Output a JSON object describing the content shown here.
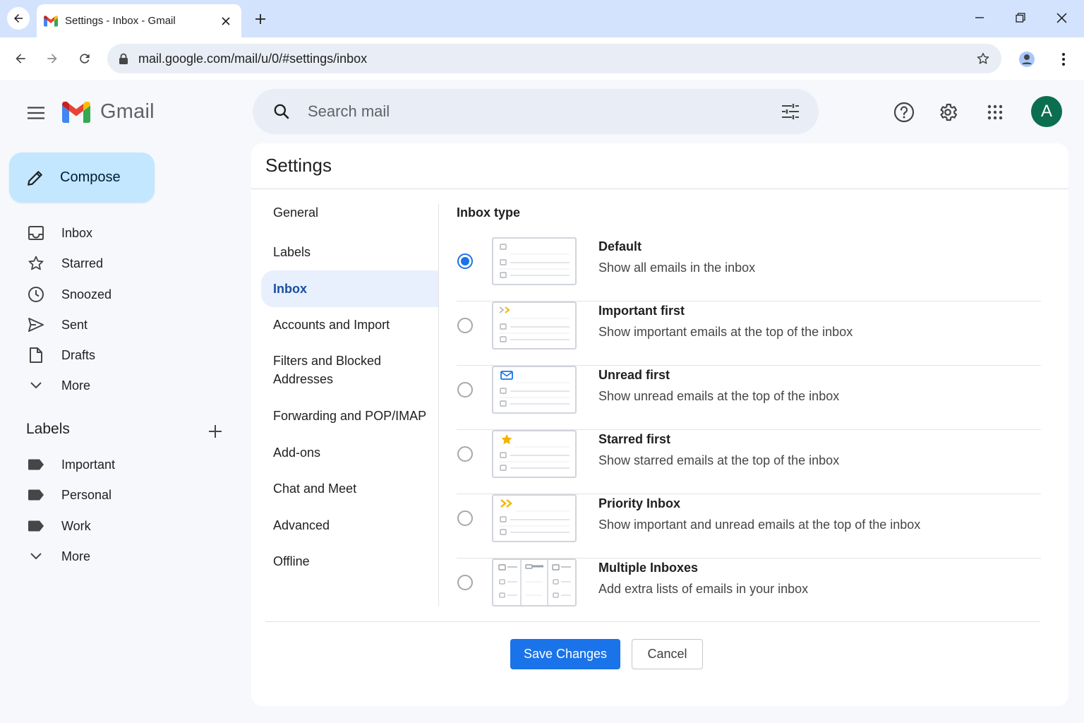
{
  "browser": {
    "tab_title": "Settings - Inbox - Gmail",
    "url": "mail.google.com/mail/u/0/#settings/inbox"
  },
  "header": {
    "app_name": "Gmail",
    "search_placeholder": "Search mail",
    "avatar_initial": "A",
    "avatar_color": "#0b6e4f"
  },
  "compose": {
    "label": "Compose"
  },
  "sidebar": {
    "items": [
      {
        "label": "Inbox",
        "icon": "inbox-icon"
      },
      {
        "label": "Starred",
        "icon": "star-icon"
      },
      {
        "label": "Snoozed",
        "icon": "clock-icon"
      },
      {
        "label": "Sent",
        "icon": "send-icon"
      },
      {
        "label": "Drafts",
        "icon": "draft-icon"
      },
      {
        "label": "More",
        "icon": "chevron-down-icon"
      }
    ],
    "labels_heading": "Labels",
    "labels": [
      {
        "label": "Important",
        "icon": "label-icon"
      },
      {
        "label": "Personal",
        "icon": "label-icon"
      },
      {
        "label": "Work",
        "icon": "label-icon"
      },
      {
        "label": "More",
        "icon": "chevron-down-icon"
      }
    ]
  },
  "settings": {
    "title": "Settings",
    "nav": [
      {
        "label": "General"
      },
      {
        "label": "Labels"
      },
      {
        "label": "Inbox",
        "active": true
      },
      {
        "label": "Accounts and Import"
      },
      {
        "label": "Filters and Blocked Addresses"
      },
      {
        "label": "Forwarding and POP/IMAP"
      },
      {
        "label": "Add-ons"
      },
      {
        "label": "Chat and Meet"
      },
      {
        "label": "Advanced"
      },
      {
        "label": "Offline"
      }
    ],
    "section_title": "Inbox type",
    "options": [
      {
        "title": "Default",
        "description": "Show all emails in the inbox",
        "selected": true,
        "thumb_icon": "none"
      },
      {
        "title": "Important first",
        "description": "Show important emails at the top of the inbox",
        "selected": false,
        "thumb_icon": "importance-icon"
      },
      {
        "title": "Unread first",
        "description": "Show unread emails at the top of the inbox",
        "selected": false,
        "thumb_icon": "envelope-icon"
      },
      {
        "title": "Starred first",
        "description": "Show starred emails at the top of the inbox",
        "selected": false,
        "thumb_icon": "star-icon"
      },
      {
        "title": "Priority Inbox",
        "description": "Show important and unread emails at the top of the inbox",
        "selected": false,
        "thumb_icon": "priority-icon"
      },
      {
        "title": "Multiple Inboxes",
        "description": "Add extra lists of emails in your inbox",
        "selected": false,
        "thumb_icon": "multiple-inboxes-icon"
      }
    ],
    "save_label": "Save Changes",
    "cancel_label": "Cancel"
  },
  "colors": {
    "accent": "#1a73e8",
    "compose_bg": "#c2e7ff",
    "active_nav_bg": "#e8f0fe",
    "tabstrip": "#d3e3fd"
  }
}
